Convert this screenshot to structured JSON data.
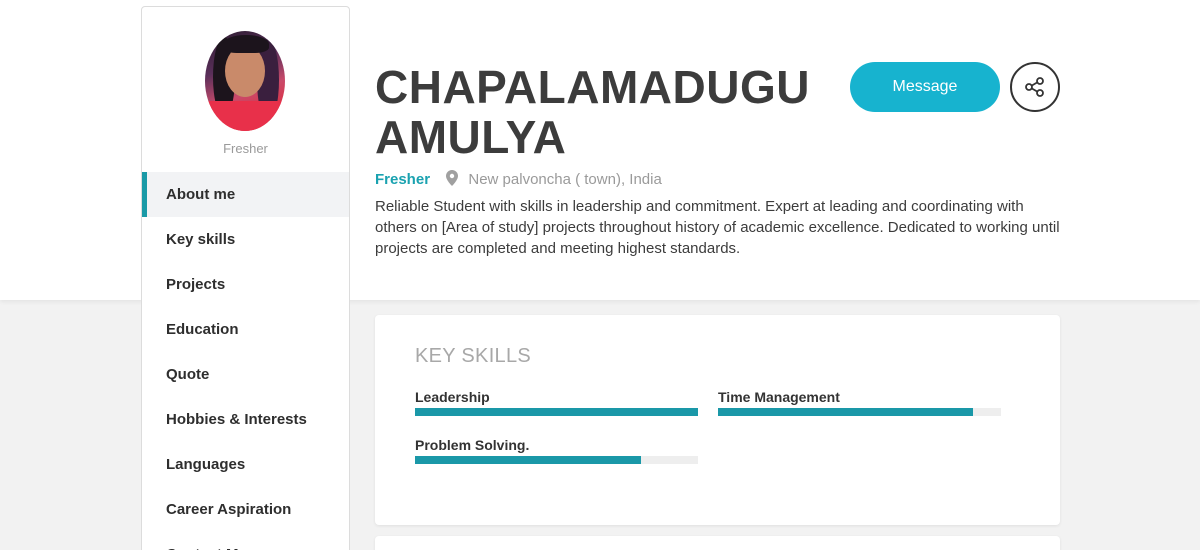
{
  "profile": {
    "name_line1": "CHAPALAMADUGU",
    "name_line2": "AMULYA",
    "status": "Fresher",
    "location": "New palvoncha ( town), India",
    "about": "Reliable Student with skills in leadership and commitment. Expert at leading and coordinating with others on [Area of study] projects throughout history of academic excellence. Dedicated to working until projects are completed and meeting highest standards."
  },
  "sidebar": {
    "status": "Fresher",
    "items": [
      {
        "label": "About me",
        "active": true
      },
      {
        "label": "Key skills"
      },
      {
        "label": "Projects"
      },
      {
        "label": "Education"
      },
      {
        "label": "Quote"
      },
      {
        "label": "Hobbies & Interests"
      },
      {
        "label": "Languages"
      },
      {
        "label": "Career Aspiration"
      },
      {
        "label": "Contact Me"
      }
    ]
  },
  "actions": {
    "message_label": "Message",
    "share_icon": "share-icon"
  },
  "key_skills": {
    "title": "KEY SKILLS",
    "skills": [
      {
        "label": "Leadership",
        "level": 1.0
      },
      {
        "label": "Time Management",
        "level": 0.9
      },
      {
        "label": "Problem Solving.",
        "level": 0.8
      }
    ]
  },
  "colors": {
    "accent": "#17b3cf",
    "bar": "#1a98a8",
    "active_marker": "#1a9aa7"
  }
}
